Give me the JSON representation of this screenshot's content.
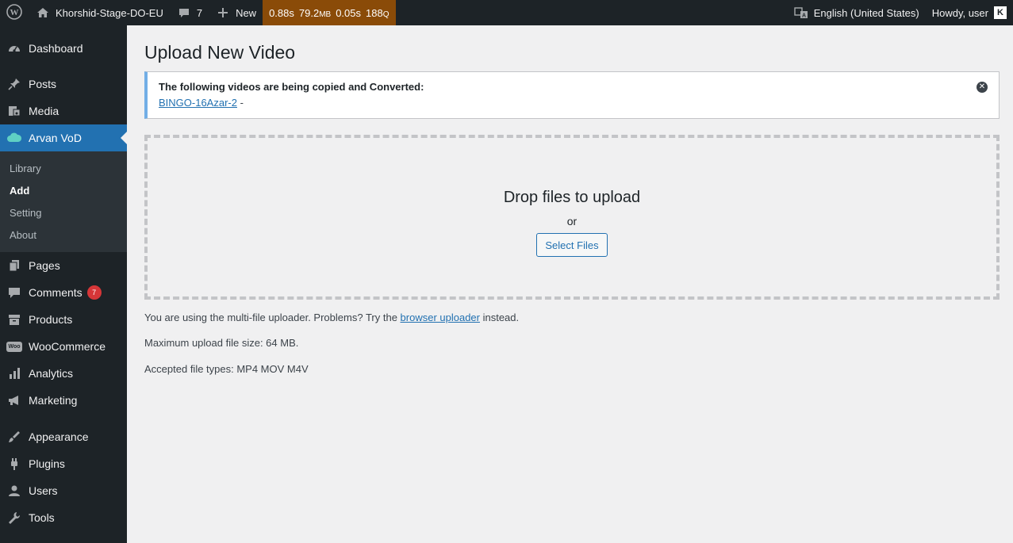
{
  "adminbar": {
    "site_name": "Khorshid-Stage-DO-EU",
    "comments_count": "7",
    "new_label": "New",
    "perf": {
      "time": "0.88s",
      "memory": "79.2",
      "memory_unit": "MB",
      "query_time": "0.05s",
      "queries": "188",
      "queries_unit": "Q"
    },
    "language": "English (United States)",
    "greeting": "Howdy, user",
    "avatar_letter": "K"
  },
  "sidebar": {
    "items": [
      {
        "label": "Dashboard",
        "icon": "dashboard-icon"
      },
      {
        "label": "Posts",
        "icon": "pin-icon"
      },
      {
        "label": "Media",
        "icon": "media-icon"
      },
      {
        "label": "Arvan VoD",
        "icon": "cloud-icon"
      },
      {
        "label": "Pages",
        "icon": "pages-icon"
      },
      {
        "label": "Comments",
        "icon": "comment-icon",
        "badge": "7"
      },
      {
        "label": "Products",
        "icon": "archive-icon"
      },
      {
        "label": "WooCommerce",
        "icon": "woo-icon",
        "icon_text": "Woo"
      },
      {
        "label": "Analytics",
        "icon": "chart-icon"
      },
      {
        "label": "Marketing",
        "icon": "megaphone-icon"
      },
      {
        "label": "Appearance",
        "icon": "brush-icon"
      },
      {
        "label": "Plugins",
        "icon": "plug-icon"
      },
      {
        "label": "Users",
        "icon": "user-icon"
      },
      {
        "label": "Tools",
        "icon": "wrench-icon"
      }
    ],
    "submenu": [
      "Library",
      "Add",
      "Setting",
      "About"
    ]
  },
  "main": {
    "title": "Upload New Video",
    "notice": {
      "heading": "The following videos are being copied and Converted:",
      "link": "BINGO-16Azar-2",
      "suffix": " -"
    },
    "dropzone": {
      "title": "Drop files to upload",
      "or": "or",
      "button": "Select Files"
    },
    "uploader_note": {
      "before": "You are using the multi-file uploader. Problems? Try the ",
      "link": "browser uploader",
      "after": " instead."
    },
    "max_size": "Maximum upload file size: 64 MB.",
    "accepted": "Accepted file types: MP4 MOV M4V"
  },
  "colors": {
    "adminbar_bg": "#1d2327",
    "perf_bg": "#8a4b08",
    "accent": "#2271b1",
    "badge": "#d63638"
  }
}
